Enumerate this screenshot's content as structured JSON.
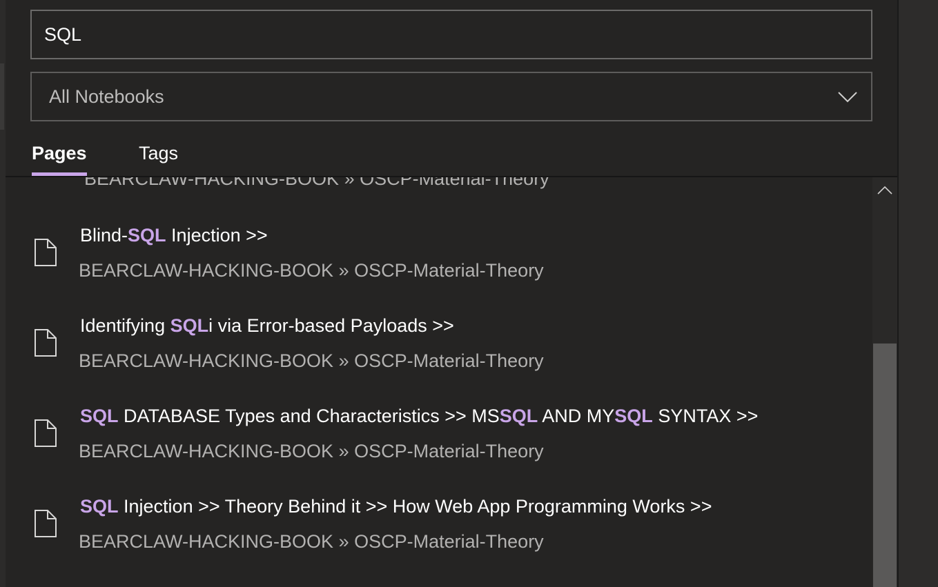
{
  "search": {
    "value": "SQL"
  },
  "notebook_filter": {
    "selected": "All Notebooks"
  },
  "tabs": {
    "pages": "Pages",
    "tags": "Tags",
    "active": "Pages"
  },
  "accent_color": "#c9a5e8",
  "partial_result": {
    "path_notebook": "BEARCLAW-HACKING-BOOK",
    "path_sep": "»",
    "path_section": "OSCP-Material-Theory"
  },
  "results": [
    {
      "title_parts": [
        {
          "text": "Blind-",
          "hl": false
        },
        {
          "text": "SQL",
          "hl": true
        },
        {
          "text": " Injection >>",
          "hl": false
        }
      ],
      "path_notebook": "BEARCLAW-HACKING-BOOK",
      "path_sep": "»",
      "path_section": "OSCP-Material-Theory",
      "icon": "page-icon"
    },
    {
      "title_parts": [
        {
          "text": "Identifying ",
          "hl": false
        },
        {
          "text": "SQL",
          "hl": true
        },
        {
          "text": "i via Error-based Payloads >>",
          "hl": false
        }
      ],
      "path_notebook": "BEARCLAW-HACKING-BOOK",
      "path_sep": "»",
      "path_section": "OSCP-Material-Theory",
      "icon": "page-icon"
    },
    {
      "title_parts": [
        {
          "text": "SQL",
          "hl": true
        },
        {
          "text": " DATABASE Types and Characteristics >> MS",
          "hl": false
        },
        {
          "text": "SQL",
          "hl": true
        },
        {
          "text": " AND MY",
          "hl": false
        },
        {
          "text": "SQL",
          "hl": true
        },
        {
          "text": " SYNTAX >>",
          "hl": false
        }
      ],
      "path_notebook": "BEARCLAW-HACKING-BOOK",
      "path_sep": "»",
      "path_section": "OSCP-Material-Theory",
      "icon": "page-icon"
    },
    {
      "title_parts": [
        {
          "text": "SQL",
          "hl": true
        },
        {
          "text": " Injection >> Theory Behind it >> How Web App Programming Works >>",
          "hl": false
        }
      ],
      "path_notebook": "BEARCLAW-HACKING-BOOK",
      "path_sep": "»",
      "path_section": "OSCP-Material-Theory",
      "icon": "page-icon"
    }
  ],
  "icons": {
    "dropdown": "chevron-down-icon",
    "scroll_up": "chevron-up-icon",
    "result": "page-icon"
  }
}
